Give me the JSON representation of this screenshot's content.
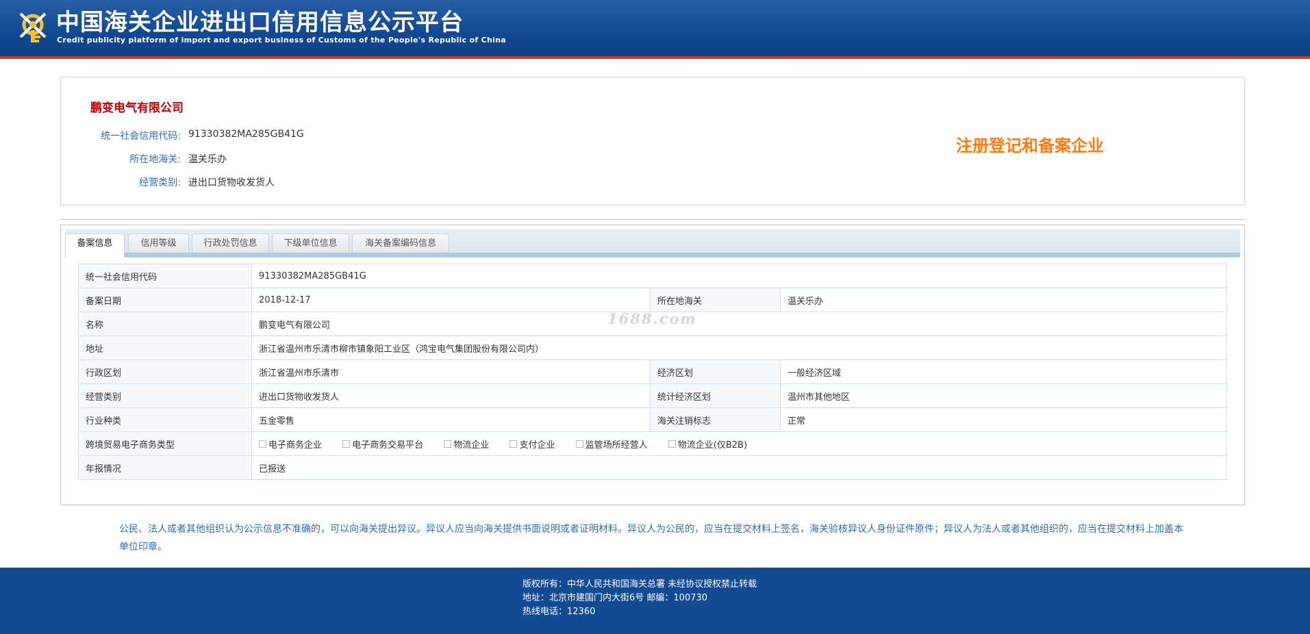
{
  "header": {
    "title": "中国海关企业进出口信用信息公示平台",
    "subtitle": "Credit publicity platform of import and export business of Customs of the People's Republic of China",
    "logo_icon": "customs-key-emblem-icon"
  },
  "summary": {
    "company_name": "鹏变电气有限公司",
    "rows": [
      {
        "label": "统一社会信用代码:",
        "value": "91330382MA285GB41G"
      },
      {
        "label": "所在地海关:",
        "value": "温关乐办"
      },
      {
        "label": "经营类别:",
        "value": "进出口货物收发货人"
      }
    ],
    "stamp": "注册登记和备案企业",
    "stamp_color": "#ff7a14"
  },
  "tabs": [
    {
      "label": "备案信息",
      "active": true
    },
    {
      "label": "信用等级",
      "active": false
    },
    {
      "label": "行政处罚信息",
      "active": false
    },
    {
      "label": "下级单位信息",
      "active": false
    },
    {
      "label": "海关备案编码信息",
      "active": false
    }
  ],
  "details": {
    "credit_code_label": "统一社会信用代码",
    "credit_code": "91330382MA285GB41G",
    "record_date_label": "备案日期",
    "record_date": "2018-12-17",
    "customs_label": "所在地海关",
    "customs": "温关乐办",
    "name_label": "名称",
    "name": "鹏变电气有限公司",
    "address_label": "地址",
    "address": "浙江省温州市乐清市柳市镇象阳工业区（鸿宝电气集团股份有限公司内）",
    "region_label": "行政区划",
    "region": "浙江省温州市乐清市",
    "econ_zone_label": "经济区划",
    "econ_zone": "一般经济区域",
    "business_type_label": "经营类别",
    "business_type": "进出口货物收发货人",
    "stat_zone_label": "统计经济区划",
    "stat_zone": "温州市其他地区",
    "industry_label": "行业种类",
    "industry": "五金零售",
    "cancel_flag_label": "海关注销标志",
    "cancel_flag": "正常",
    "ecommerce_label": "跨境贸易电子商务类型",
    "ecommerce_options": [
      "电子商务企业",
      "电子商务交易平台",
      "物流企业",
      "支付企业",
      "监管场所经营人",
      "物流企业(仅B2B)"
    ],
    "annual_report_label": "年报情况",
    "annual_report": "已报送"
  },
  "watermark": "1688.com",
  "notice": "公民、法人或者其他组织认为公示信息不准确的，可以向海关提出异议。异议人应当向海关提供书面说明或者证明材料。异议人为公民的，应当在提交材料上签名，海关验核异议人身份证件原件；异议人为法人或者其他组织的，应当在提交材料上加盖本单位印章。",
  "footer": {
    "copyright": "版权所有：中华人民共和国海关总署   未经协议授权禁止转载",
    "address": "地址：北京市建国门内大街6号 邮编：100730",
    "hotline": "热线电话：12360"
  },
  "colors": {
    "header_blue": "#124a94",
    "header_red_line": "#c63a2c",
    "company_red": "#c00000",
    "label_blue": "#2f6db0"
  }
}
